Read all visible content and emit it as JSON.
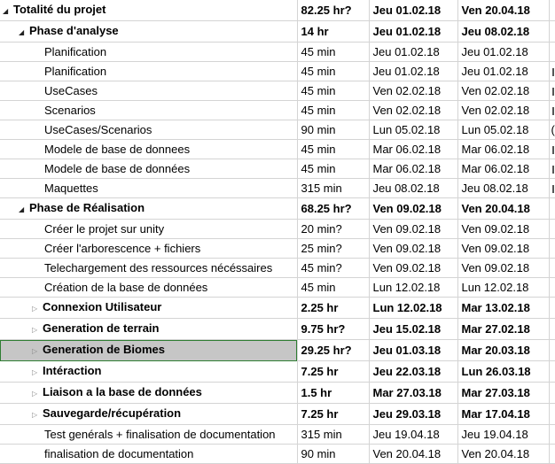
{
  "tasks": [
    {
      "name": "Totalité du projet",
      "duration": "82.25 hr?",
      "start": "Jeu 01.02.18",
      "finish": "Ven 20.04.18",
      "level": 0,
      "summary": true,
      "toggle": "open",
      "edge": ""
    },
    {
      "name": "Phase d'analyse",
      "duration": "14 hr",
      "start": "Jeu 01.02.18",
      "finish": "Jeu 08.02.18",
      "level": 1,
      "summary": true,
      "toggle": "open",
      "edge": ""
    },
    {
      "name": "Planification",
      "duration": "45 min",
      "start": "Jeu 01.02.18",
      "finish": "Jeu 01.02.18",
      "level": 2,
      "summary": false,
      "toggle": "",
      "edge": ""
    },
    {
      "name": "Planification",
      "duration": "45 min",
      "start": "Jeu 01.02.18",
      "finish": "Jeu 01.02.18",
      "level": 2,
      "summary": false,
      "toggle": "",
      "edge": "mark"
    },
    {
      "name": "UseCases",
      "duration": "45 min",
      "start": "Ven 02.02.18",
      "finish": "Ven 02.02.18",
      "level": 2,
      "summary": false,
      "toggle": "",
      "edge": "mark"
    },
    {
      "name": "Scenarios",
      "duration": "45 min",
      "start": "Ven 02.02.18",
      "finish": "Ven 02.02.18",
      "level": 2,
      "summary": false,
      "toggle": "",
      "edge": "mark"
    },
    {
      "name": "UseCases/Scenarios",
      "duration": "90 min",
      "start": "Lun 05.02.18",
      "finish": "Lun 05.02.18",
      "level": 2,
      "summary": false,
      "toggle": "",
      "edge": "("
    },
    {
      "name": "Modele de base de donnees",
      "duration": "45 min",
      "start": "Mar 06.02.18",
      "finish": "Mar 06.02.18",
      "level": 2,
      "summary": false,
      "toggle": "",
      "edge": "mark"
    },
    {
      "name": "Modele de base de données",
      "duration": "45 min",
      "start": "Mar 06.02.18",
      "finish": "Mar 06.02.18",
      "level": 2,
      "summary": false,
      "toggle": "",
      "edge": "mark"
    },
    {
      "name": "Maquettes",
      "duration": "315 min",
      "start": "Jeu 08.02.18",
      "finish": "Jeu 08.02.18",
      "level": 2,
      "summary": false,
      "toggle": "",
      "edge": "mark"
    },
    {
      "name": "Phase de Réalisation",
      "duration": "68.25 hr?",
      "start": "Ven 09.02.18",
      "finish": "Ven 20.04.18",
      "level": 1,
      "summary": true,
      "toggle": "open",
      "edge": ""
    },
    {
      "name": "Créer le projet sur unity",
      "duration": "20 min?",
      "start": "Ven 09.02.18",
      "finish": "Ven 09.02.18",
      "level": 2,
      "summary": false,
      "toggle": "",
      "edge": ""
    },
    {
      "name": "Créer l'arborescence + fichiers",
      "duration": "25 min?",
      "start": "Ven 09.02.18",
      "finish": "Ven 09.02.18",
      "level": 2,
      "summary": false,
      "toggle": "",
      "edge": ""
    },
    {
      "name": "Telechargement des ressources nécéssaires",
      "duration": "45 min?",
      "start": "Ven 09.02.18",
      "finish": "Ven 09.02.18",
      "level": 2,
      "summary": false,
      "toggle": "",
      "edge": ""
    },
    {
      "name": "Création de la base de données",
      "duration": "45 min",
      "start": "Lun 12.02.18",
      "finish": "Lun 12.02.18",
      "level": 2,
      "summary": false,
      "toggle": "",
      "edge": ""
    },
    {
      "name": "Connexion Utilisateur",
      "duration": "2.25 hr",
      "start": "Lun 12.02.18",
      "finish": "Mar 13.02.18",
      "level": 2,
      "summary": true,
      "toggle": "closed",
      "edge": ""
    },
    {
      "name": "Generation de terrain",
      "duration": "9.75 hr?",
      "start": "Jeu 15.02.18",
      "finish": "Mar 27.02.18",
      "level": 2,
      "summary": true,
      "toggle": "closed",
      "edge": ""
    },
    {
      "name": "Generation de Biomes",
      "duration": "29.25 hr?",
      "start": "Jeu 01.03.18",
      "finish": "Mar 20.03.18",
      "level": 2,
      "summary": true,
      "toggle": "closed",
      "edge": "",
      "selected": true
    },
    {
      "name": "Intéraction",
      "duration": "7.25 hr",
      "start": "Jeu 22.03.18",
      "finish": "Lun 26.03.18",
      "level": 2,
      "summary": true,
      "toggle": "closed",
      "edge": ""
    },
    {
      "name": "Liaison a la base de données",
      "duration": "1.5 hr",
      "start": "Mar 27.03.18",
      "finish": "Mar 27.03.18",
      "level": 2,
      "summary": true,
      "toggle": "closed",
      "edge": ""
    },
    {
      "name": "Sauvegarde/récupération",
      "duration": "7.25 hr",
      "start": "Jeu 29.03.18",
      "finish": "Mar 17.04.18",
      "level": 2,
      "summary": true,
      "toggle": "closed",
      "edge": ""
    },
    {
      "name": "Test genérals + finalisation de documentation",
      "duration": "315 min",
      "start": "Jeu 19.04.18",
      "finish": "Jeu 19.04.18",
      "level": 2,
      "summary": false,
      "toggle": "",
      "edge": ""
    },
    {
      "name": "finalisation de documentation",
      "duration": "90 min",
      "start": "Ven 20.04.18",
      "finish": "Ven 20.04.18",
      "level": 2,
      "summary": false,
      "toggle": "",
      "edge": ""
    }
  ],
  "icons": {
    "open": "triangle-down-icon",
    "closed": "triangle-right-icon"
  }
}
